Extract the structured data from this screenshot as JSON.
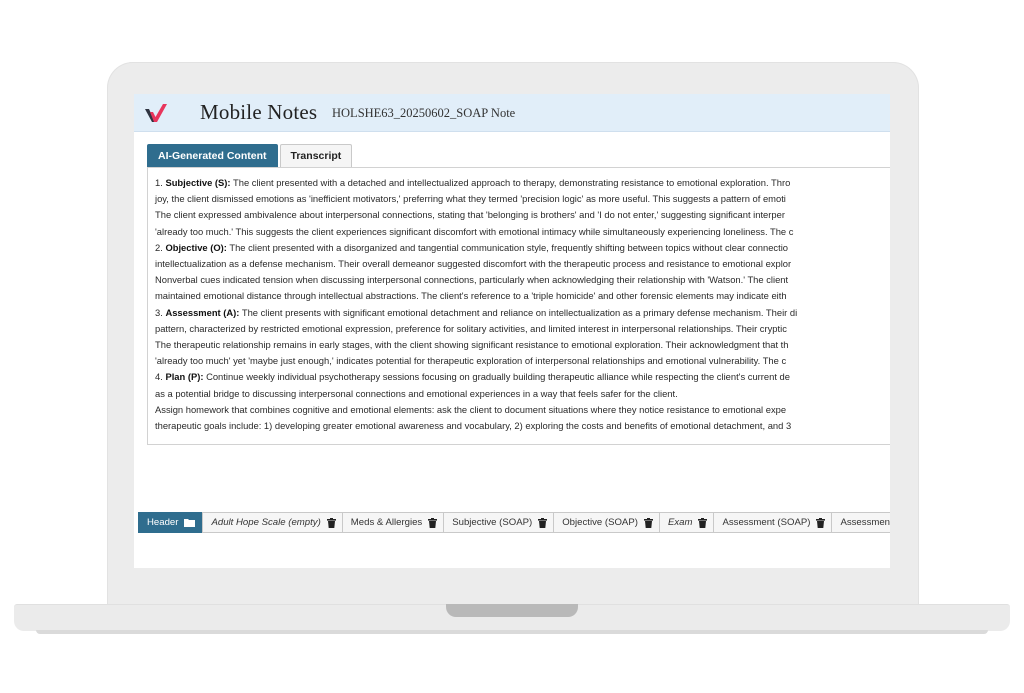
{
  "app": {
    "title": "Mobile Notes",
    "document_title": "HOLSHE63_20250602_SOAP Note",
    "brand_color": "#e8355c",
    "accent_color": "#2f6d8e"
  },
  "content_tabs": [
    {
      "label": "AI-Generated Content",
      "active": true
    },
    {
      "label": "Transcript",
      "active": false
    }
  ],
  "note": {
    "lines": [
      {
        "bold": "",
        "prefix": "1. ",
        "heading": "Subjective (S):",
        "text": " The client presented with a detached and intellectualized approach to therapy, demonstrating resistance to emotional exploration. Thro"
      },
      {
        "prefix": "",
        "heading": "",
        "text": "joy, the client dismissed emotions as 'inefficient motivators,' preferring what they termed 'precision logic' as more useful. This suggests a pattern of emoti"
      },
      {
        "prefix": "",
        "heading": "",
        "text": "The client expressed ambivalence about interpersonal connections, stating that 'belonging is brothers' and 'I do not enter,' suggesting significant interper"
      },
      {
        "prefix": "",
        "heading": "",
        "text": "'already too much.' This suggests the client experiences significant discomfort with emotional intimacy while simultaneously experiencing loneliness. The c"
      },
      {
        "prefix": "2. ",
        "heading": "Objective (O):",
        "text": " The client presented with a disorganized and tangential communication style, frequently shifting between topics without clear connectio"
      },
      {
        "prefix": "",
        "heading": "",
        "text": "intellectualization as a defense mechanism. Their overall demeanor suggested discomfort with the therapeutic process and resistance to emotional explor"
      },
      {
        "prefix": "",
        "heading": "",
        "text": "Nonverbal cues indicated tension when discussing interpersonal connections, particularly when acknowledging their relationship with 'Watson.' The client"
      },
      {
        "prefix": "",
        "heading": "",
        "text": "maintained emotional distance through intellectual abstractions. The client's reference to a 'triple homicide' and other forensic elements may indicate eith"
      },
      {
        "prefix": "3. ",
        "heading": "Assessment (A):",
        "text": " The client presents with significant emotional detachment and reliance on intellectualization as a primary defense mechanism. Their di"
      },
      {
        "prefix": "",
        "heading": "",
        "text": "pattern, characterized by restricted emotional expression, preference for solitary activities, and limited interest in interpersonal relationships. Their cryptic"
      },
      {
        "prefix": "",
        "heading": "",
        "text": "The therapeutic relationship remains in early stages, with the client showing significant resistance to emotional exploration. Their acknowledgment that th"
      },
      {
        "prefix": "",
        "heading": "",
        "text": "'already too much' yet 'maybe just enough,' indicates potential for therapeutic exploration of interpersonal relationships and emotional vulnerability. The c"
      },
      {
        "prefix": "4. ",
        "heading": "Plan (P):",
        "text": " Continue weekly individual psychotherapy sessions focusing on gradually building therapeutic alliance while respecting the client's current de"
      },
      {
        "prefix": "",
        "heading": "",
        "text": "as a potential bridge to discussing interpersonal connections and emotional experiences in a way that feels safer for the client."
      },
      {
        "prefix": "",
        "heading": "",
        "text": "Assign homework that combines cognitive and emotional elements: ask the client to document situations where they notice resistance to emotional expe"
      },
      {
        "prefix": "",
        "heading": "",
        "text": "therapeutic goals include: 1) developing greater emotional awareness and vocabulary, 2) exploring the costs and benefits of emotional detachment, and 3"
      }
    ]
  },
  "section_tabs": [
    {
      "label": "Header",
      "active": true,
      "italic": false,
      "icon": "folder-icon"
    },
    {
      "label": "Adult Hope Scale (empty)",
      "active": false,
      "italic": true,
      "icon": "trash-icon"
    },
    {
      "label": "Meds & Allergies",
      "active": false,
      "italic": false,
      "icon": "trash-icon"
    },
    {
      "label": "Subjective (SOAP)",
      "active": false,
      "italic": false,
      "icon": "trash-icon"
    },
    {
      "label": "Objective (SOAP)",
      "active": false,
      "italic": false,
      "icon": "trash-icon"
    },
    {
      "label": "Exam",
      "active": false,
      "italic": true,
      "icon": "trash-icon"
    },
    {
      "label": "Assessment (SOAP)",
      "active": false,
      "italic": false,
      "icon": "trash-icon"
    },
    {
      "label": "Assessmen",
      "active": false,
      "italic": false,
      "icon": "trash-icon"
    }
  ]
}
